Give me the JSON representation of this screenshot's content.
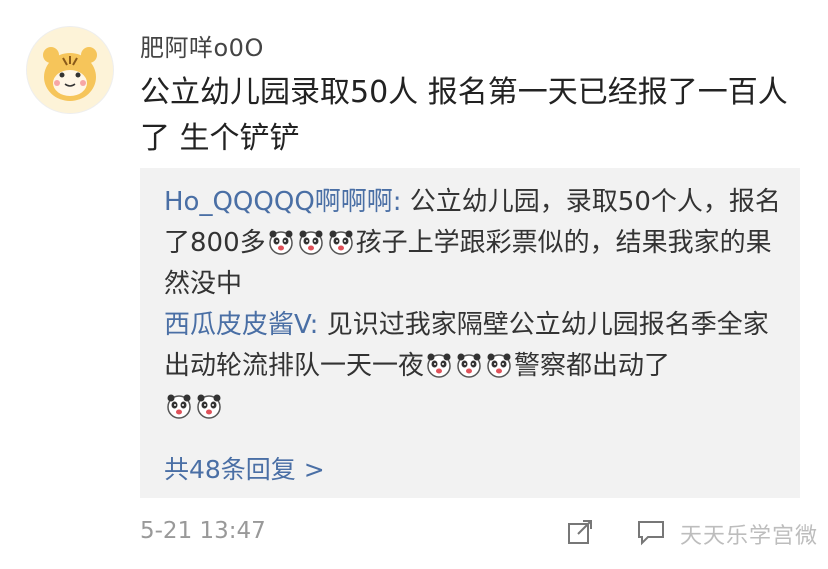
{
  "post": {
    "username": "肥阿咩o0O",
    "text": "公立幼儿园录取50人 报名第一天已经报了一百人\n了 生个铲铲",
    "timestamp": "5-21 13:47"
  },
  "replies": [
    {
      "author": "Ho_QQQQQ啊啊啊:",
      "text_before": " 公立幼儿园，录取50个人，报名了800多",
      "emoji_count": 3,
      "text_after": "孩子上学跟彩票似的，结果我家的果然没中"
    },
    {
      "author": "西瓜皮皮酱V:",
      "text_before": " 见识过我家隔壁公立幼儿园报名季全家出动轮流排队一天一夜",
      "emoji_count": 3,
      "text_mid": "警察都出动了",
      "emoji_count_end": 2
    }
  ],
  "more_replies": "共48条回复 >",
  "watermark": "天天乐学宫微",
  "icons": {
    "avatar": "tiger-avatar-icon",
    "share": "share-icon",
    "comment": "comment-icon",
    "emoji": "panda-emoji-icon"
  },
  "colors": {
    "link": "#4a6fa5",
    "panel": "#f2f2f2",
    "muted": "#999999"
  }
}
